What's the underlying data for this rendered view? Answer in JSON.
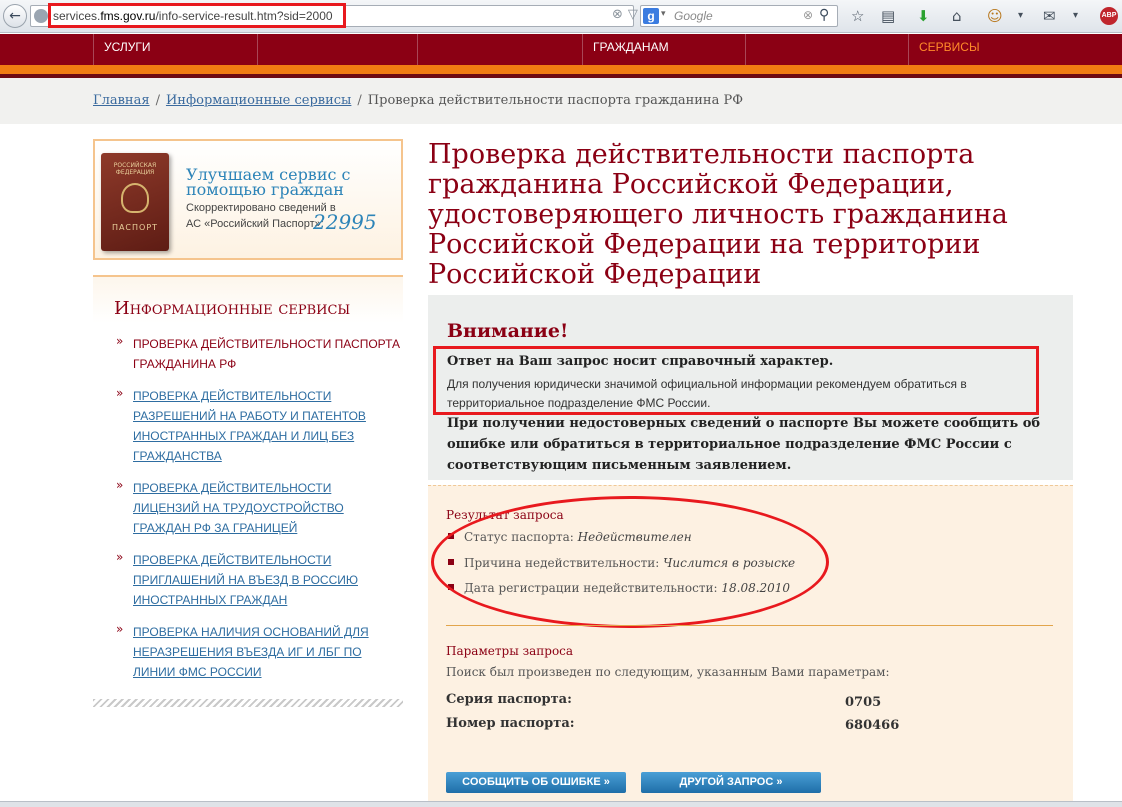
{
  "browser": {
    "back_icon": "←",
    "url_prefix": "services.",
    "url_domain": "fms.gov.ru",
    "url_path": "/info-service-result.htm?sid=2000",
    "url_tools": [
      "⊗",
      "▽",
      "↻"
    ],
    "search_engine_letter": "g",
    "search_caret": "▾",
    "search_placeholder": "Google",
    "search_clear": "⊗",
    "search_go": "⚲",
    "toolbar_icons": [
      "☆",
      "▤",
      "⬇",
      "⌂",
      "☺",
      "▾",
      "✉",
      "▾"
    ],
    "abp_label": "ABP"
  },
  "site_nav": {
    "items": [
      {
        "label": "УСЛУГИ",
        "active": false
      },
      {
        "label": "",
        "active": false
      },
      {
        "label": "",
        "active": false
      },
      {
        "label": "ГРАЖДАНАМ",
        "active": false
      },
      {
        "label": "",
        "active": false
      },
      {
        "label": "СЕРВИСЫ",
        "active": true
      }
    ]
  },
  "breadcrumb": {
    "home": "Главная",
    "sep1": "/",
    "services": "Информационные сервисы",
    "sep2": "/",
    "current": "Проверка действительности паспорта гражданина РФ"
  },
  "promo": {
    "passport_top": "РОССИЙСКАЯ ФЕДЕРАЦИЯ",
    "passport_bottom": "ПАСПОРТ",
    "title": "Улучшаем сервис с помощью граждан",
    "text": "Скорректировано сведений в АС «Российский Паспорт»:",
    "count": "22995"
  },
  "services": {
    "title": "Информационные сервисы",
    "bullet": "»",
    "items": [
      {
        "label": "Проверка действительности паспорта гражданина РФ",
        "current": true
      },
      {
        "label": "Проверка действительности разрешений на работу и патентов иностранных граждан и лиц без гражданства",
        "current": false
      },
      {
        "label": "Проверка действительности лицензий на трудоустройство граждан РФ за границей",
        "current": false
      },
      {
        "label": "Проверка действительности приглашений на въезд в Россию иностранных граждан",
        "current": false
      },
      {
        "label": "Проверка наличия оснований для неразрешения въезда ИГ и ЛБГ по линии ФМС России",
        "current": false
      }
    ]
  },
  "main": {
    "title": "Проверка действительности паспорта гражданина Российской Федерации, удостоверяющего личность гражданина Российской Федерации на территории Российской Федерации",
    "warning": {
      "title": "Внимание!",
      "bold_line": "Ответ на Ваш запрос носит справочный характер.",
      "text": "Для получения юридически значимой официальной информации рекомендуем обратиться в территориальное подразделение ФМС России.",
      "bold_para": "При получении недостоверных сведений о паспорте Вы можете сообщить об ошибке или обратиться в территориальное подразделение ФМС России с соответствующим письменным заявлением."
    },
    "result": {
      "title": "Результат запроса",
      "items": [
        {
          "label": "Статус паспорта:",
          "value": "Недействителен"
        },
        {
          "label": "Причина недействительности:",
          "value": "Числится в розыске"
        },
        {
          "label": "Дата регистрации недействительности:",
          "value": "18.08.2010"
        }
      ]
    },
    "params": {
      "title": "Параметры запроса",
      "text": "Поиск был произведен по следующим, указанным Вами параметрам:",
      "series_label": "Серия паспорта:",
      "series_value": "0705",
      "number_label": "Номер паспорта:",
      "number_value": "680466"
    },
    "buttons": {
      "report": "СООБЩИТЬ ОБ ОШИБКЕ »",
      "another": "ДРУГОЙ ЗАПРОС »"
    }
  },
  "colors": {
    "brand_red": "#8b0014",
    "orange": "#f17c12",
    "link_blue": "#2e6da1",
    "annotation_red": "#e8191e"
  }
}
